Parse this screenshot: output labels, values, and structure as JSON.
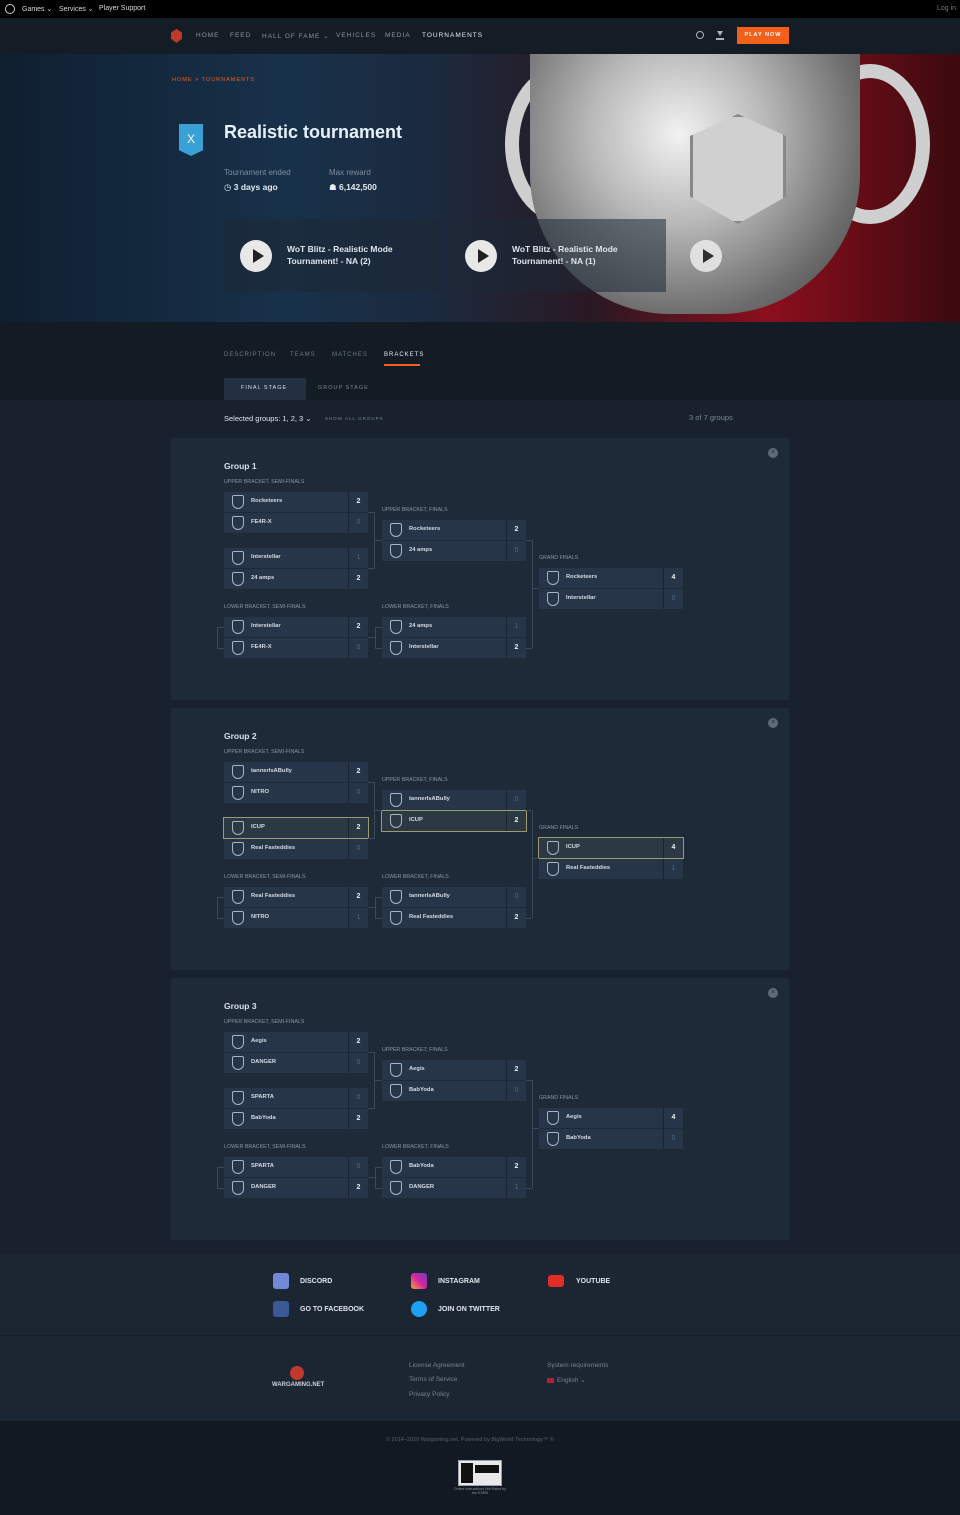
{
  "system_bar": {
    "games": "Games ⌄",
    "services": "Services ⌄",
    "support": "Player Support",
    "login": "Log in"
  },
  "nav": {
    "home": "HOME",
    "feed": "FEED",
    "hall": "HALL OF FAME ⌄",
    "vehicles": "VEHICLES",
    "media": "MEDIA",
    "tournaments": "TOURNAMENTS",
    "play": "PLAY NOW"
  },
  "hero": {
    "breadcrumb": "HOME > TOURNAMENTS",
    "badge": "X",
    "title": "Realistic tournament",
    "ended_label": "Tournament ended",
    "ended_value": "◷ 3 days ago",
    "reward_label": "Max reward",
    "reward_value": "☗ 6,142,500",
    "videos": [
      "WoT Blitz - Realistic Mode Tournament! - NA (2)",
      "WoT Blitz - Realistic Mode Tournament! - NA (1)"
    ]
  },
  "tabs": {
    "description": "DESCRIPTION",
    "teams": "TEAMS",
    "matches": "MATCHES",
    "brackets": "BRACKETS"
  },
  "subtabs": {
    "final": "FINAL STAGE",
    "group": "GROUP STAGE"
  },
  "filters": {
    "selected": "Selected groups: 1, 2, 3 ⌄",
    "show_all": "SHOW ALL GROUPS",
    "count": "3 of 7 groups"
  },
  "labels": {
    "ub_semis": "UPPER BRACKET, SEMI-FINALS",
    "ub_finals": "UPPER BRACKET, FINALS",
    "lb_semis": "LOWER BRACKET, SEMI-FINALS",
    "lb_finals": "LOWER BRACKET, FINALS",
    "grand": "GRAND FINALS"
  },
  "groups": [
    {
      "title": "Group 1",
      "ub_semi1": [
        [
          "Rocketeers",
          "2"
        ],
        [
          "FE4R-X",
          "0"
        ]
      ],
      "ub_semi2": [
        [
          "Interstellar",
          "1"
        ],
        [
          "24 amps",
          "2"
        ]
      ],
      "ub_final": [
        [
          "Rocketeers",
          "2"
        ],
        [
          "24 amps",
          "0"
        ]
      ],
      "lb_semi": [
        [
          "Interstellar",
          "2"
        ],
        [
          "FE4R-X",
          "0"
        ]
      ],
      "lb_final": [
        [
          "24 amps",
          "1"
        ],
        [
          "Interstellar",
          "2"
        ]
      ],
      "grand": [
        [
          "Rocketeers",
          "4"
        ],
        [
          "Interstellar",
          "0"
        ]
      ]
    },
    {
      "title": "Group 2",
      "ub_semi1": [
        [
          "tannerIsABully",
          "2"
        ],
        [
          "NITRO",
          "0"
        ]
      ],
      "ub_semi2": [
        [
          "ICUP",
          "2"
        ],
        [
          "Real Fasteddies",
          "0"
        ]
      ],
      "ub_final": [
        [
          "tannerIsABully",
          "0"
        ],
        [
          "ICUP",
          "2"
        ]
      ],
      "lb_semi": [
        [
          "Real Fasteddies",
          "2"
        ],
        [
          "NITRO",
          "1"
        ]
      ],
      "lb_final": [
        [
          "tannerIsABully",
          "0"
        ],
        [
          "Real Fasteddies",
          "2"
        ]
      ],
      "grand": [
        [
          "ICUP",
          "4"
        ],
        [
          "Real Fasteddies",
          "1"
        ]
      ]
    },
    {
      "title": "Group 3",
      "ub_semi1": [
        [
          "Aegis",
          "2"
        ],
        [
          "DANGER",
          "0"
        ]
      ],
      "ub_semi2": [
        [
          "SPARTA",
          "0"
        ],
        [
          "BabYoda",
          "2"
        ]
      ],
      "ub_final": [
        [
          "Aegis",
          "2"
        ],
        [
          "BabYoda",
          "0"
        ]
      ],
      "lb_semi": [
        [
          "SPARTA",
          "0"
        ],
        [
          "DANGER",
          "2"
        ]
      ],
      "lb_final": [
        [
          "BabYoda",
          "2"
        ],
        [
          "DANGER",
          "1"
        ]
      ],
      "grand": [
        [
          "Aegis",
          "4"
        ],
        [
          "BabYoda",
          "0"
        ]
      ]
    }
  ],
  "footer": {
    "discord": "DISCORD",
    "instagram": "INSTAGRAM",
    "youtube": "YOUTUBE",
    "facebook": "GO TO FACEBOOK",
    "twitter": "JOIN ON TWITTER",
    "brand": "WARGAMING.NET",
    "license": "License Agreement",
    "terms": "Terms of Service",
    "privacy": "Privacy Policy",
    "sysreq": "System requirements",
    "lang": "English ⌄",
    "copyright": "© 2014–2020 Wargaming.net. Powered by BigWorld Technology™ ©",
    "rating_note": "Online Interactions Not Rated by the ESRB"
  },
  "colors": {
    "accent": "#f2601a",
    "panel": "#1f2a38",
    "row": "#263548"
  }
}
